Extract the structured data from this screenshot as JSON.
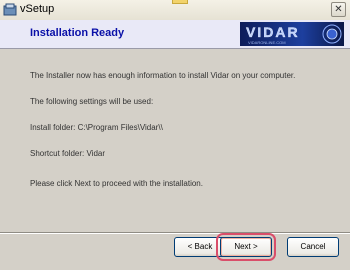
{
  "window": {
    "title": "vSetup",
    "close_glyph": "✕",
    "icon": "setup-app-icon"
  },
  "header": {
    "title": "Installation Ready",
    "logo_text": "VIDAR",
    "logo_subtext": "VIDARONLINE.COM"
  },
  "body": {
    "intro": "The Installer now has enough information to install Vidar on your computer.",
    "settings_heading": "The following settings will be used:",
    "install_folder": "Install folder:  C:\\Program Files\\Vidar\\\\",
    "shortcut_folder": "Shortcut folder:  Vidar",
    "prompt": "Please click Next to proceed with the installation."
  },
  "buttons": {
    "back": "< Back",
    "next": "Next >",
    "cancel": "Cancel"
  },
  "colors": {
    "header_title": "#0a10a8",
    "focus_highlight": "#d94e6a"
  }
}
